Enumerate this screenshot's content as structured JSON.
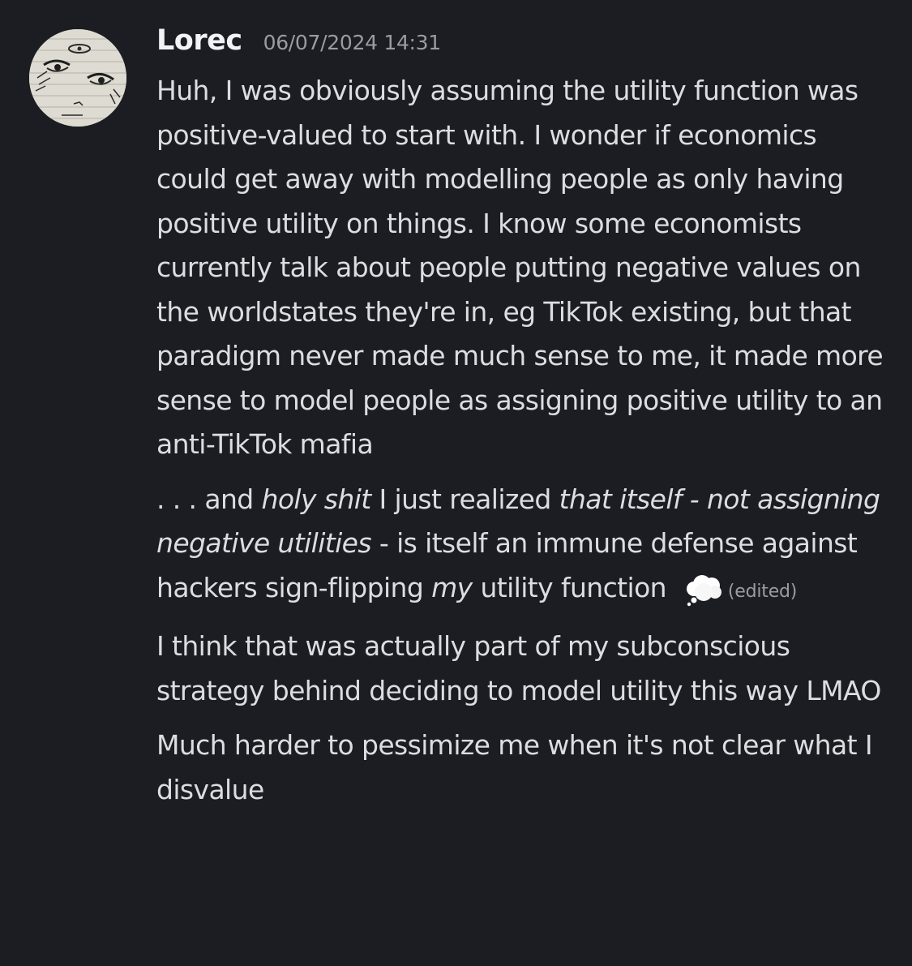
{
  "message": {
    "author": "Lorec",
    "timestamp": "06/07/2024 14:31",
    "paragraph1": "Huh, I was obviously assuming the utility function was positive-valued to start with. I wonder if economics could get away with modelling people as only having positive utility on things. I know some economists currently talk about people putting negative values on the worldstates they're in, eg TikTok existing, but that paradigm never made much sense to me, it made more sense to model people as assigning positive utility to an anti-TikTok mafia",
    "paragraph2": {
      "part1": ". . . and ",
      "italic1": "holy shit",
      "part2": " I just realized ",
      "italic2": "that itself - not assigning negative utilities",
      "part3": " - is itself an immune defense against hackers sign-flipping ",
      "italic3": "my",
      "part4": " utility function ",
      "emoji": "thought-balloon-icon",
      "edited": "(edited)"
    },
    "paragraph3": "I think that was actually part of my subconscious strategy behind deciding to model utility this way LMAO",
    "paragraph4": "Much harder to pessimize me when it's not clear what I disvalue"
  },
  "colors": {
    "background": "#1c1d22",
    "text": "#dcdde1",
    "username": "#f2f3f5",
    "muted": "#9a9ca3"
  }
}
